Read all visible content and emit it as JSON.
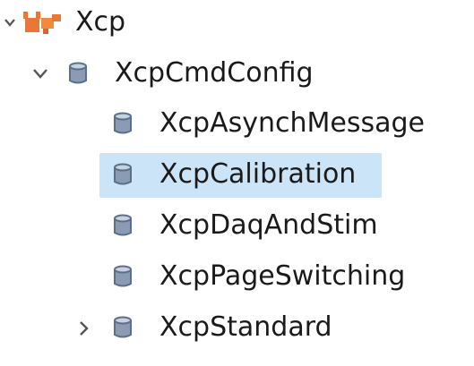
{
  "colors": {
    "selection": "#cce4f7",
    "text": "#1a1a1a",
    "chevron": "#555555",
    "db_icon": "#6b7f9a",
    "module_icon": "#e8783a"
  },
  "tree": {
    "root": {
      "label": "Xcp",
      "icon": "puzzle-module-icon",
      "expanded": true
    },
    "config": {
      "label": "XcpCmdConfig",
      "icon": "database-icon",
      "expanded": true
    },
    "items": [
      {
        "label": "XcpAsynchMessage",
        "icon": "database-icon",
        "selected": false
      },
      {
        "label": "XcpCalibration",
        "icon": "database-icon",
        "selected": true
      },
      {
        "label": "XcpDaqAndStim",
        "icon": "database-icon",
        "selected": false
      },
      {
        "label": "XcpPageSwitching",
        "icon": "database-icon",
        "selected": false
      },
      {
        "label": "XcpStandard",
        "icon": "database-icon",
        "selected": false,
        "expandable": true,
        "expanded": false
      }
    ]
  }
}
